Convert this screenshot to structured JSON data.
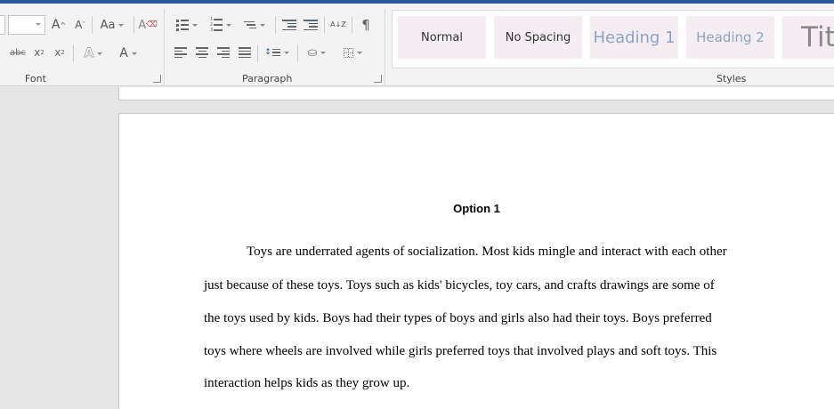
{
  "ribbon": {
    "groups": {
      "font": "Font",
      "paragraph": "Paragraph",
      "styles": "Styles"
    },
    "font_buttons": {
      "grow": "A",
      "shrink": "A",
      "change_case": "Aa",
      "strikethrough": "abc",
      "subscript": "x",
      "superscript": "x",
      "text_effects": "A",
      "font_color": "A",
      "sub_mark": "2",
      "super_mark": "2"
    },
    "paragraph_buttons": {
      "sort": "A↓Z",
      "show_marks": "¶"
    },
    "styles": [
      "Normal",
      "No Spacing",
      "Heading 1",
      "Heading 2",
      "Titl"
    ]
  },
  "document": {
    "title": "Option 1",
    "lines": [
      "Toys are underrated agents of socialization. Most kids mingle and interact with each other",
      "just because of these toys. Toys such as kids' bicycles, toy cars, and crafts drawings are some of",
      "the toys used by kids. Boys had their types of boys and girls also had their toys. Boys preferred",
      "toys where wheels are involved while girls preferred toys that involved plays and soft toys. This",
      "interaction helps kids as they grow up."
    ]
  },
  "colors": {
    "title_bar": "#2b579a",
    "ribbon_bg": "#f3f3f3",
    "canvas_bg": "#e6e6e6",
    "style_tile_bg": "#f4eef2"
  }
}
